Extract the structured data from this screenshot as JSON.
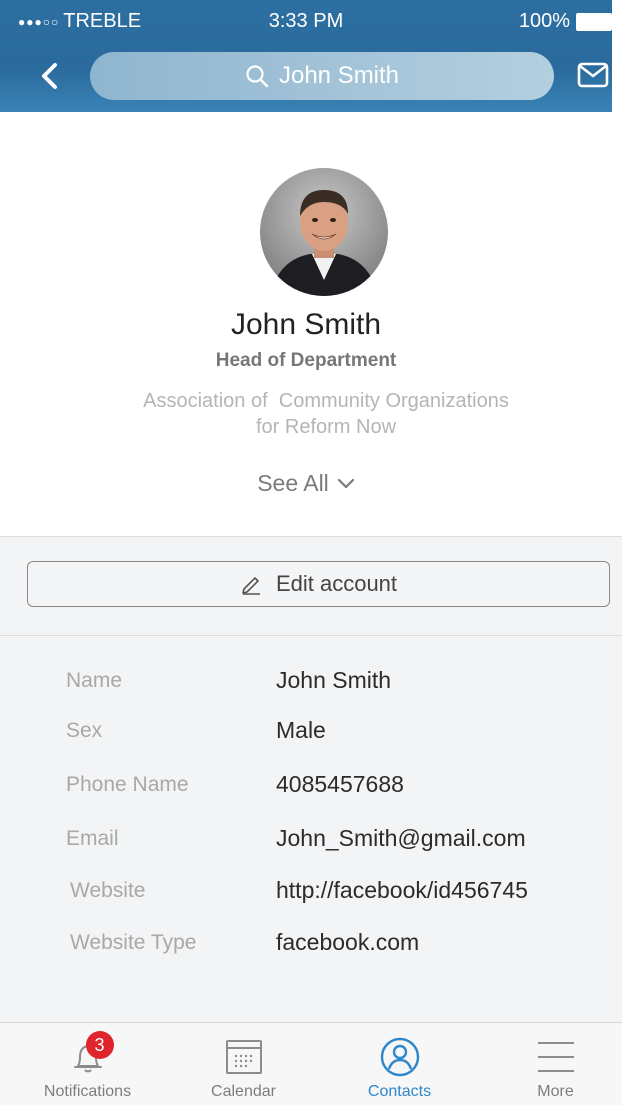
{
  "status_bar": {
    "signal": "●●●○○",
    "carrier": "TREBLE",
    "time": "3:33 PM",
    "battery": "100%"
  },
  "nav": {
    "search_text": "John Smith",
    "back_icon": "chevron-left-icon",
    "mail_icon": "envelope-icon"
  },
  "profile": {
    "name": "John Smith",
    "title": "Head of Department",
    "organization_line1": "Association of  Community Organizations",
    "organization_line2": "for Reform Now",
    "see_all": "See All"
  },
  "edit_button": {
    "label": "Edit account",
    "icon": "pencil-icon"
  },
  "details": [
    {
      "label": "Name",
      "value": "John Smith"
    },
    {
      "label": "Sex",
      "value": "Male"
    },
    {
      "label": "Phone Name",
      "value": "4085457688"
    },
    {
      "label": "Email",
      "value": "John_Smith@gmail.com"
    },
    {
      "label": "Website",
      "value": "http://facebook/id456745"
    },
    {
      "label": "Website Type",
      "value": "facebook.com"
    }
  ],
  "tabs": [
    {
      "label": "Notifications",
      "icon": "bell-icon",
      "badge": "3"
    },
    {
      "label": "Calendar",
      "icon": "calendar-icon"
    },
    {
      "label": "Contacts",
      "icon": "contacts-icon",
      "active": true
    },
    {
      "label": "More",
      "icon": "menu-icon"
    }
  ],
  "colors": {
    "header": "#2a6a9c",
    "accent": "#2f86c9",
    "badge": "#e0242c"
  }
}
